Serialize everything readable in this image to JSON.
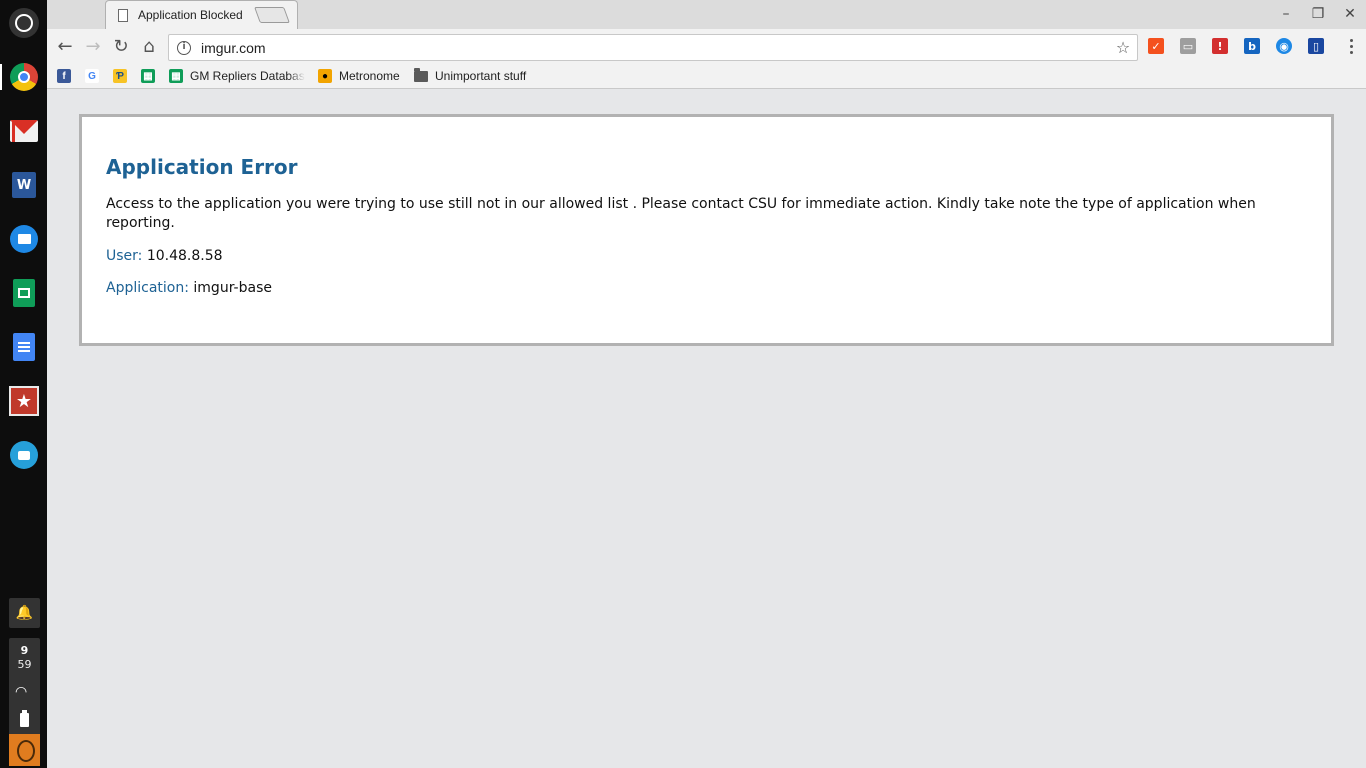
{
  "browser": {
    "tab": {
      "title": "Application Blocked",
      "close": "✕"
    },
    "window_controls": {
      "minimize": "–",
      "maximize": "❐",
      "close": "✕"
    },
    "nav": {
      "back": "←",
      "forward": "→",
      "reload": "↻",
      "home": "⌂"
    },
    "omnibox": {
      "info_icon": "i",
      "url": "imgur.com",
      "star": "☆"
    },
    "extensions": [
      {
        "name": "orange-extension-icon",
        "glyph": "✓",
        "color": "#f4511e"
      },
      {
        "name": "grey-extension-icon",
        "glyph": "▭",
        "color": "#9e9e9e"
      },
      {
        "name": "exclamation-extension-icon",
        "glyph": "!",
        "color": "#d32f2f"
      },
      {
        "name": "b-extension-icon",
        "glyph": "b",
        "color": "#1565c0"
      },
      {
        "name": "eye-extension-icon",
        "glyph": "◉",
        "color": "#1e88e5"
      },
      {
        "name": "book-extension-icon",
        "glyph": "▯",
        "color": "#1a47a0"
      }
    ],
    "bookmarks": [
      {
        "name": "facebook",
        "glyph": "f",
        "color": "#3b5998",
        "label": ""
      },
      {
        "name": "google",
        "glyph": "G",
        "color": "#ffffff",
        "label": ""
      },
      {
        "name": "python",
        "glyph": "Ƥ",
        "color": "#f7c325",
        "label": ""
      },
      {
        "name": "sheets",
        "glyph": "▦",
        "color": "#0f9d58",
        "label": ""
      },
      {
        "name": "gm-repliers",
        "glyph": "▦",
        "color": "#0f9d58",
        "label": "GM Repliers Database"
      },
      {
        "name": "metronome",
        "glyph": "●",
        "color": "#f2a400",
        "label": "Metronome"
      },
      {
        "name": "unimportant-folder",
        "glyph": "",
        "color": "#5a5a5a",
        "label": "Unimportant stuff"
      }
    ]
  },
  "shelf": {
    "clock": {
      "hour": "9",
      "minute": "59"
    },
    "wifi": "◠",
    "notifications": "🔔",
    "word_letter": "W",
    "wunderlist_glyph": "★"
  },
  "page": {
    "title": "Application Error",
    "message": "Access to the application you were trying to use still not in our allowed list . Please contact CSU for immediate action. Kindly take note the type of application when reporting.",
    "user_label": "User:",
    "user_value": "10.48.8.58",
    "application_label": "Application:",
    "application_value": "imgur-base"
  }
}
